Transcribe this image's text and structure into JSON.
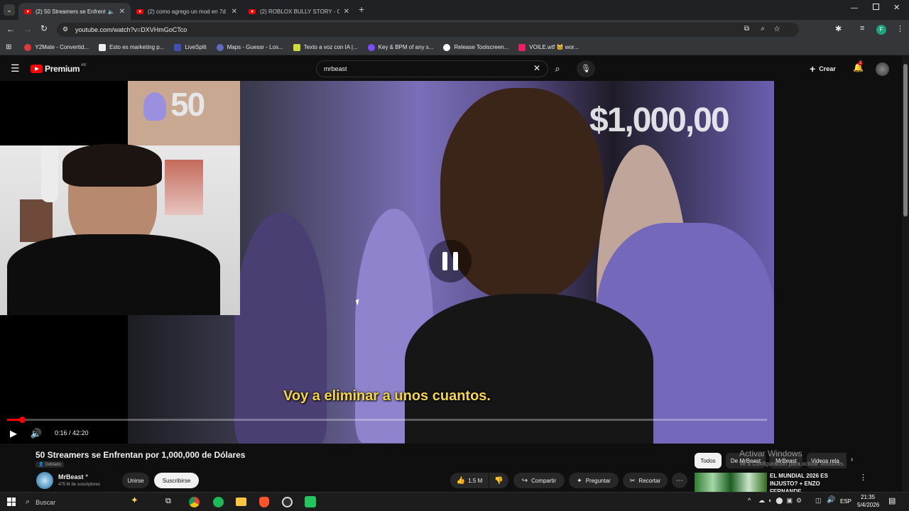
{
  "tabs": [
    {
      "title": "(2) 50 Streamers se Enfrentan"
    },
    {
      "title": "(2) como agrego un mod en 7d"
    },
    {
      "title": "(2) ROBLOX BULLY STORY - Ga"
    }
  ],
  "address": {
    "url": "youtube.com/watch?v=DXVHmGoCTco"
  },
  "bookmarks": [
    {
      "label": "Y2Mate - Convertid...",
      "color": "#e53935"
    },
    {
      "label": "Esto es marketing p...",
      "color": "#eeeeee"
    },
    {
      "label": "LiveSplit",
      "color": "#3f51b5"
    },
    {
      "label": "Maps - Guessr - Los...",
      "color": "#5c6bc0"
    },
    {
      "label": "Texto a voz con IA |...",
      "color": "#cddc39"
    },
    {
      "label": "Key & BPM of any s...",
      "color": "#7c4dff"
    },
    {
      "label": "Release Toolscreen...",
      "color": "#ffffff"
    },
    {
      "label": "VOILE.wtf 🐱 wor...",
      "color": "#e91e63"
    }
  ],
  "yt": {
    "logo": "Premium",
    "logo_region": "AR",
    "search_value": "mrbeast",
    "create_label": "Crear",
    "notif_count": "2"
  },
  "video": {
    "overlay_badge": "50",
    "caption": "Voy a eliminar a unos cuantos.",
    "time": "0:16 / 42:20",
    "progress_fraction": 0.0063
  },
  "meta": {
    "title": "50 Streamers se Enfrentan por 1,000,000 de Dólares",
    "dubbed": "Doblado",
    "channel": "MrBeast",
    "subscribers": "475 M de suscriptores",
    "join": "Unirse",
    "subscribe": "Suscribirse",
    "likes": "1.5 M",
    "share": "Compartir",
    "ask": "Preguntar",
    "clip": "Recortar"
  },
  "chips": [
    "Todos",
    "De MrBeast",
    "MrBeast",
    "Videos rela"
  ],
  "activate": {
    "title": "Activar Windows",
    "subtitle": "Ve a Configuración para activar Windows."
  },
  "suggestion": {
    "title": "EL MUNDIAL 2026 ES INJUSTO? + ENZO FERNANDE..."
  },
  "taskbar": {
    "search": "Buscar",
    "lang": "ESP",
    "time": "21:35",
    "date": "5/4/2026"
  },
  "colors": {
    "accent": "#ff0000",
    "caption": "#f5d547",
    "background": "#0f0f0f"
  }
}
